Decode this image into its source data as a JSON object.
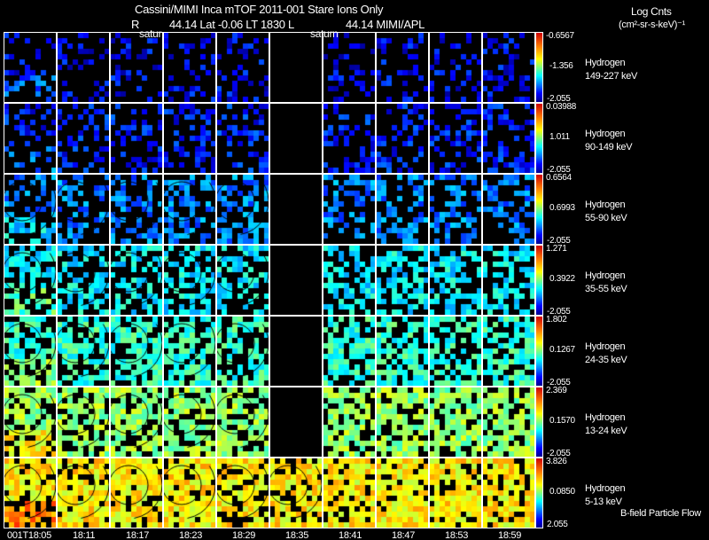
{
  "header": {
    "title": "Cassini/MIMI Inca mTOF  2011-001    Stare    Ions Only",
    "subtitle_r": "R",
    "subtitle_mid": "44.14 Lat -0.06 LT 1830 L",
    "subtitle_right": "44.14  MIMI/APL",
    "overlay_left": "satur",
    "overlay_mid": "saturn"
  },
  "units": {
    "line1": "Log Cnts",
    "line2": "(cm²-sr-s-keV)⁻¹"
  },
  "footer_note": "B-field Particle Flow",
  "chart_data": {
    "type": "heatmap",
    "title": "Cassini/MIMI Inca mTOF  2011-001 Stare Ions Only",
    "x_tick_labels": [
      "001T18:05",
      "18:11",
      "18:17",
      "18:23",
      "18:29",
      "18:35",
      "18:41",
      "18:47",
      "18:53",
      "18:59"
    ],
    "empty_columns_by_row": [
      [
        5
      ],
      [
        5
      ],
      [
        5
      ],
      [
        5
      ],
      [
        5
      ],
      [
        5
      ],
      []
    ],
    "rows": [
      {
        "species": "Hydrogen",
        "energy": "149-227 keV",
        "cmax": "-0.6567",
        "cmid": "-1.356",
        "cmin": "-2.055",
        "level": 0.12
      },
      {
        "species": "Hydrogen",
        "energy": "90-149 keV",
        "cmax": "0.03988",
        "cmid": "1.011",
        "cmin": "-2.055",
        "level": 0.15
      },
      {
        "species": "Hydrogen",
        "energy": "55-90 keV",
        "cmax": "0.6564",
        "cmid": "0.6993",
        "cmin": "-2.055",
        "level": 0.25
      },
      {
        "species": "Hydrogen",
        "energy": "35-55 keV",
        "cmax": "1.271",
        "cmid": "0.3922",
        "cmin": "-2.055",
        "level": 0.36
      },
      {
        "species": "Hydrogen",
        "energy": "24-35 keV",
        "cmax": "1.802",
        "cmid": "0.1267",
        "cmin": "-2.055",
        "level": 0.42
      },
      {
        "species": "Hydrogen",
        "energy": "13-24 keV",
        "cmax": "2.369",
        "cmid": "0.1570",
        "cmin": "-2.055",
        "level": 0.52
      },
      {
        "species": "Hydrogen",
        "energy": "5-13 keV",
        "cmax": "3.826",
        "cmid": "0.0850",
        "cmin": "2.055",
        "level": 0.64
      }
    ]
  }
}
